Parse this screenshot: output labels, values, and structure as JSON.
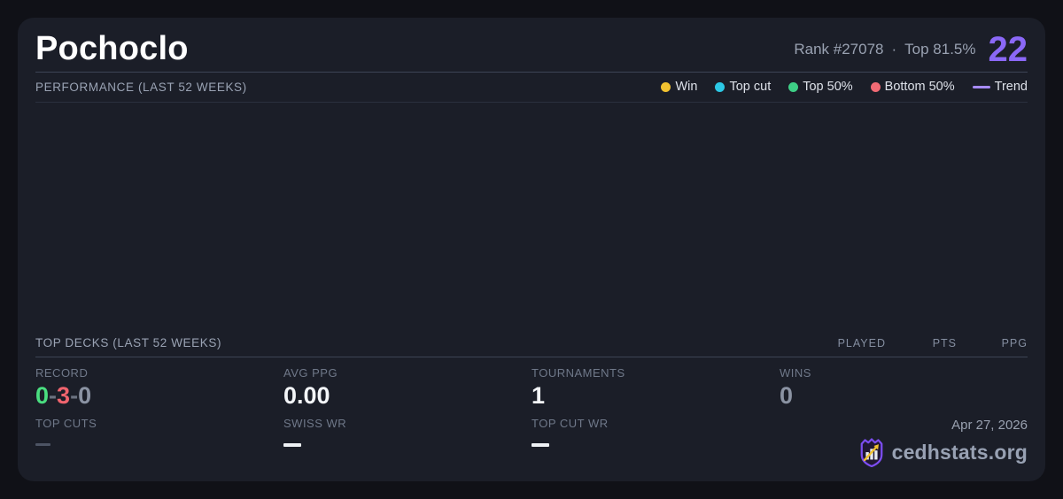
{
  "header": {
    "title": "Pochoclo",
    "rank_text": "Rank #27078",
    "separator": "·",
    "top_percent": "Top 81.5%",
    "big_number": "22"
  },
  "performance": {
    "label": "PERFORMANCE (LAST 52 WEEKS)",
    "legend": [
      {
        "label": "Win",
        "color": "#f2c230"
      },
      {
        "label": "Top cut",
        "color": "#2cc8e5"
      },
      {
        "label": "Top 50%",
        "color": "#3ecf86"
      },
      {
        "label": "Bottom 50%",
        "color": "#f16a74"
      },
      {
        "label": "Trend",
        "color": "#a78bfa"
      }
    ]
  },
  "top_decks": {
    "label": "TOP DECKS (LAST 52 WEEKS)",
    "columns": {
      "played": "PLAYED",
      "pts": "PTS",
      "ppg": "PPG"
    }
  },
  "stats": {
    "record": {
      "label": "RECORD",
      "wins": "0",
      "losses": "3",
      "draws": "0",
      "sep": "-",
      "wins_color": "#4ade80",
      "losses_color": "#f0646e",
      "draws_color": "#8b93a3"
    },
    "avg_ppg": {
      "label": "AVG PPG",
      "value": "0.00"
    },
    "tournaments": {
      "label": "TOURNAMENTS",
      "value": "1"
    },
    "wins": {
      "label": "WINS",
      "value": "0"
    },
    "top_cuts": {
      "label": "TOP CUTS",
      "dash_color": "#4d5464"
    },
    "swiss_wr": {
      "label": "SWISS WR",
      "dash_color": "#eef1f5"
    },
    "top_cut_wr": {
      "label": "TOP CUT WR",
      "dash_color": "#eef1f5"
    }
  },
  "footer": {
    "date": "Apr 27, 2026",
    "brand": "cedhstats.org"
  },
  "colors": {
    "accent_purple": "#8b68f7",
    "card_bg": "#1b1e28",
    "page_bg": "#101117"
  }
}
